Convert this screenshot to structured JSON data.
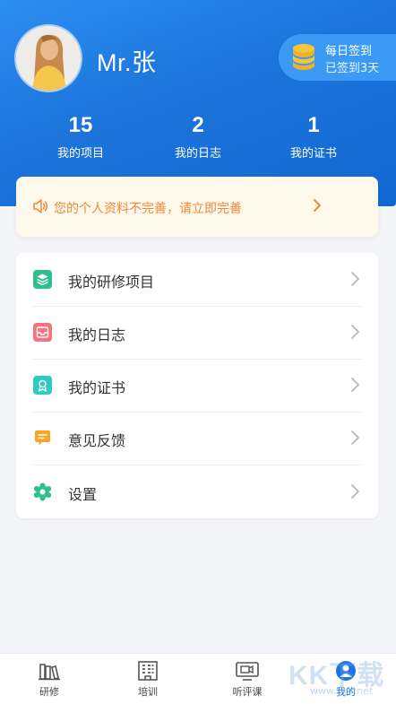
{
  "profile": {
    "username": "Mr.张",
    "avatar_icon": "user-avatar-photo"
  },
  "checkin": {
    "title": "每日签到",
    "subtitle": "已签到3天",
    "icon": "coin-stack-icon"
  },
  "stats": [
    {
      "value": "15",
      "label": "我的项目"
    },
    {
      "value": "2",
      "label": "我的日志"
    },
    {
      "value": "1",
      "label": "我的证书"
    }
  ],
  "notice": {
    "text": "您的个人资料不完善，请立即完善",
    "icon": "speaker-icon"
  },
  "menu": [
    {
      "label": "我的研修项目",
      "icon": "layers-icon",
      "color": "#2fbf8f"
    },
    {
      "label": "我的日志",
      "icon": "inbox-icon",
      "color": "#f4737d"
    },
    {
      "label": "我的证书",
      "icon": "certificate-icon",
      "color": "#2fc9c6"
    },
    {
      "label": "意见反馈",
      "icon": "feedback-icon",
      "color": "#f7a522"
    },
    {
      "label": "设置",
      "icon": "settings-icon",
      "color": "#2fbf8f"
    }
  ],
  "tabbar": [
    {
      "label": "研修",
      "icon": "books-icon",
      "active": false
    },
    {
      "label": "培训",
      "icon": "building-icon",
      "active": false
    },
    {
      "label": "听评课",
      "icon": "video-icon",
      "active": false
    },
    {
      "label": "我的",
      "icon": "person-icon",
      "active": true
    }
  ],
  "watermark": {
    "text": "KK下载",
    "url": "www.kkx.net"
  },
  "colors": {
    "header_blue": "#1c74db",
    "accent_blue": "#1a73e8",
    "notice_orange": "#f0883a",
    "notice_bg": "#fff9ec"
  }
}
